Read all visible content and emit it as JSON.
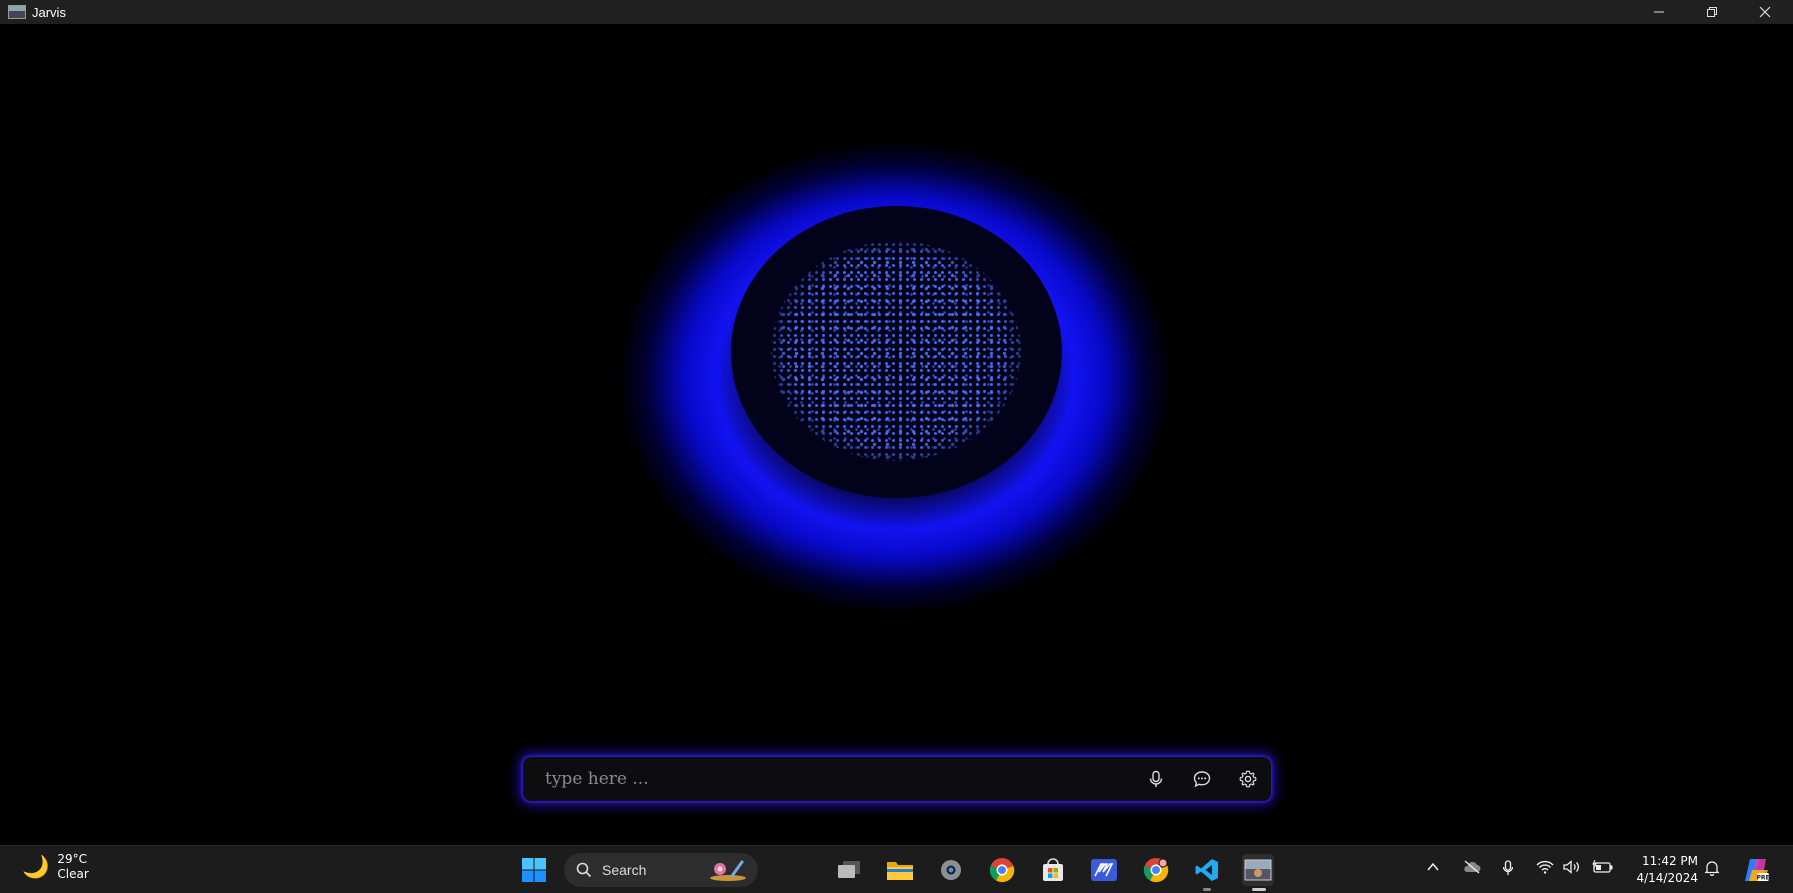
{
  "window": {
    "title": "Jarvis"
  },
  "input": {
    "placeholder": "type here ..."
  },
  "taskbar": {
    "weather": {
      "temperature": "29°C",
      "condition": "Clear"
    },
    "search_label": "Search",
    "clock": {
      "time": "11:42 PM",
      "date": "4/14/2024"
    }
  },
  "icons": {
    "mic": "microphone-icon",
    "chat": "chat-bubble-icon",
    "settings": "gear-icon"
  },
  "colors": {
    "accent_glow": "#1414ff",
    "background": "#000000",
    "taskbar": "#1c1c1c"
  }
}
